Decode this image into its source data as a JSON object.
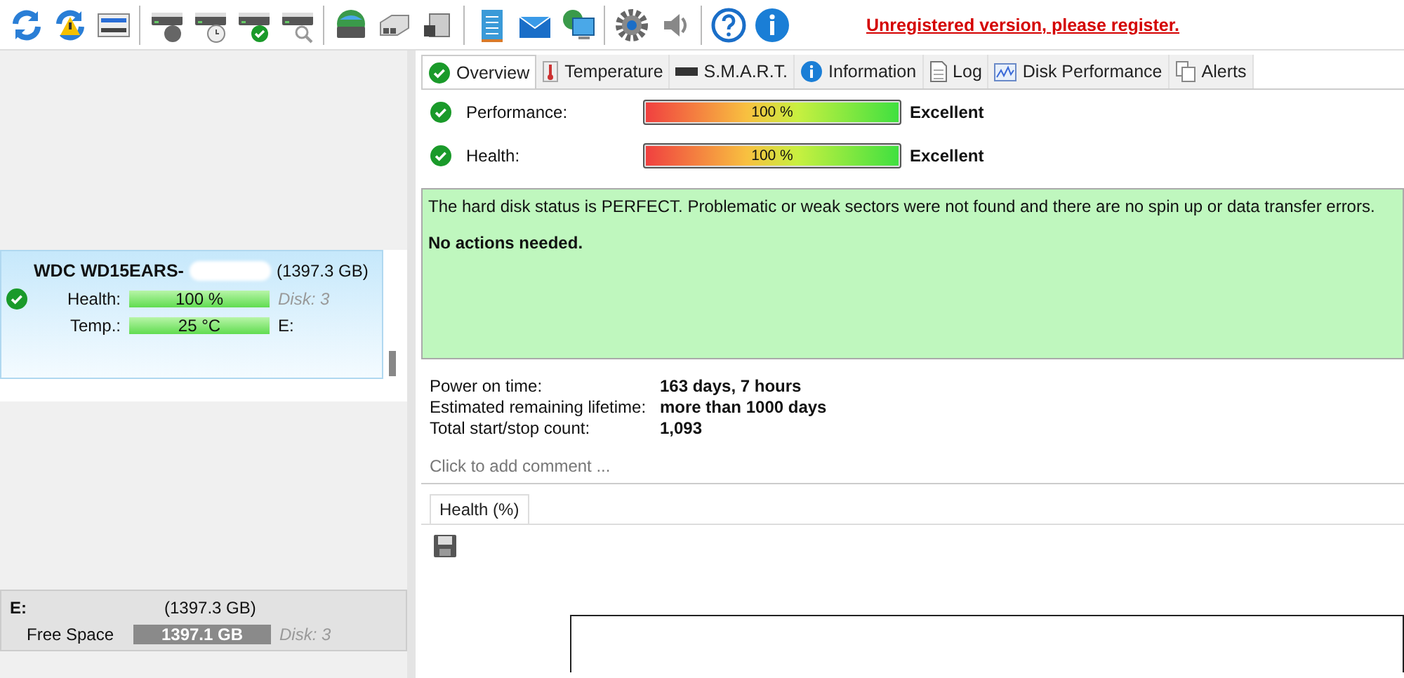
{
  "toolbar": {
    "register_link": "Unregistered version, please register."
  },
  "disk_list": [
    {
      "name": "WDC WD15EARS-",
      "size": "(1397.3 GB)",
      "selected": true,
      "ok": true,
      "health_label": "Health:",
      "health": {
        "value": "100 %",
        "level": 1
      },
      "temp_label": "Temp.:",
      "temp": {
        "value": "25 °C",
        "level": 1
      },
      "disk": "Disk: 3",
      "volume": "E:"
    }
  ],
  "volume_list": [
    {
      "name": "E:",
      "size": "(1397.3 GB)",
      "free_label": "Free Space",
      "free": "1397.1 GB",
      "level": 1,
      "disk": "Disk: 3"
    }
  ],
  "tabs": [
    {
      "label": "Overview",
      "kind": "check",
      "selected": true
    },
    {
      "label": "Temperature",
      "kind": "thermometer",
      "selected": false
    },
    {
      "label": "S.M.A.R.T.",
      "kind": "bar",
      "selected": false
    },
    {
      "label": "Information",
      "kind": "info",
      "selected": false
    },
    {
      "label": "Log",
      "kind": "page",
      "selected": false
    },
    {
      "label": "Disk Performance",
      "kind": "graph",
      "selected": false
    },
    {
      "label": "Alerts",
      "kind": "pages",
      "selected": false
    }
  ],
  "status": [
    {
      "label": "Performance:",
      "value": "100 %",
      "level": 1,
      "rating": "Excellent"
    },
    {
      "label": "Health:",
      "value": "100 %",
      "level": 1,
      "rating": "Excellent"
    }
  ],
  "message": {
    "text": "The hard disk status is PERFECT. Problematic or weak sectors were not found and there are no spin up or data transfer errors.",
    "action": "No actions needed."
  },
  "stats": [
    {
      "label": "Power on time:",
      "value": "163 days, 7 hours"
    },
    {
      "label": "Estimated remaining lifetime:",
      "value": "more than 1000 days"
    },
    {
      "label": "Total start/stop count:",
      "value": "1,093"
    }
  ],
  "comment": {
    "placeholder": "Click to add comment ..."
  },
  "chart_tabs": [
    {
      "label": "Health (%)",
      "selected": true
    }
  ]
}
